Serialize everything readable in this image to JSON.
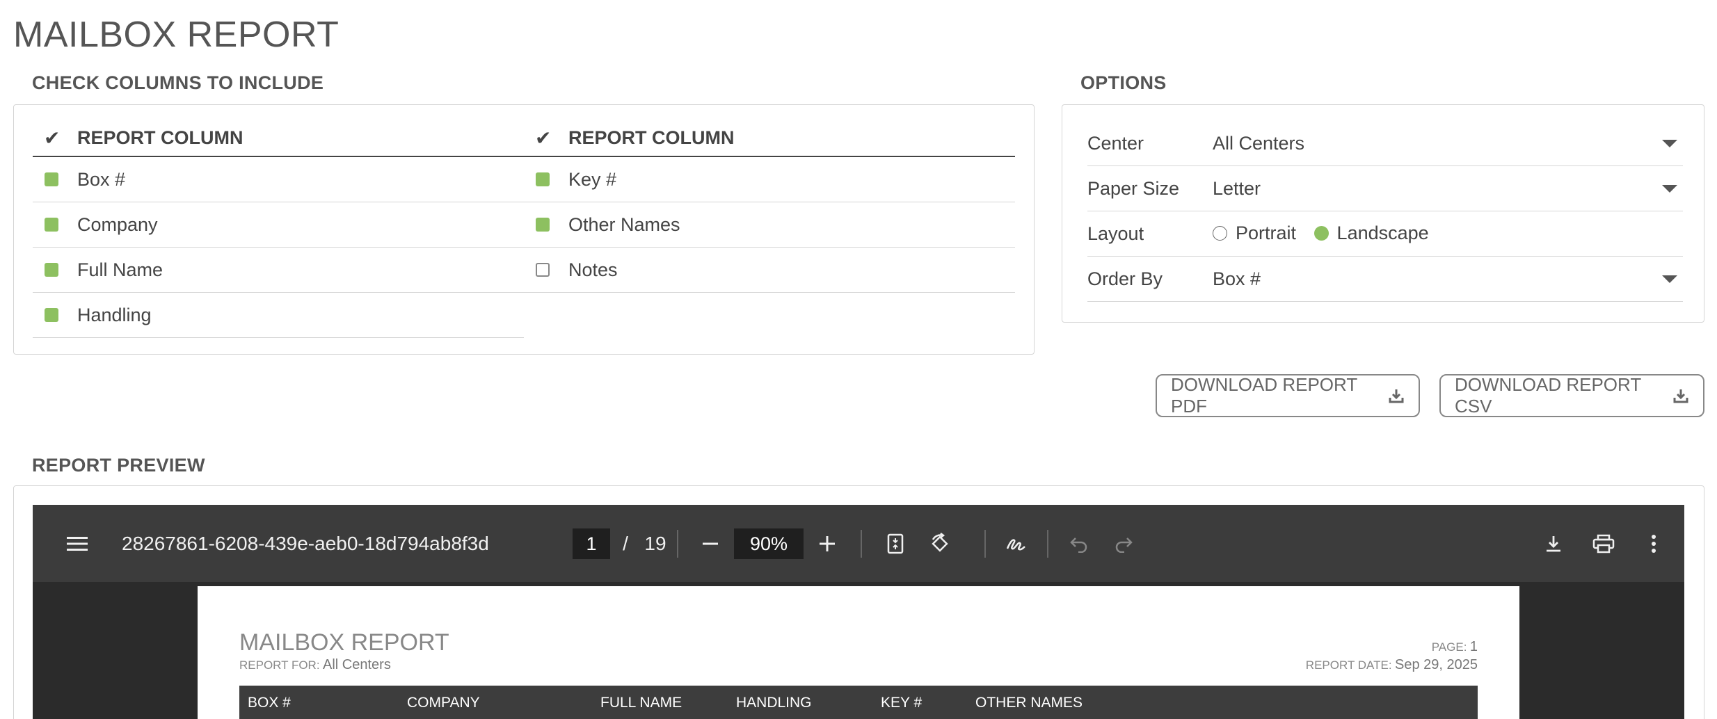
{
  "page": {
    "title": "MAILBOX REPORT"
  },
  "columns_section": {
    "heading": "CHECK COLUMNS TO INCLUDE",
    "left": {
      "header": "REPORT COLUMN",
      "items": [
        {
          "label": "Box #",
          "checked": true
        },
        {
          "label": "Company",
          "checked": true
        },
        {
          "label": "Full Name",
          "checked": true
        },
        {
          "label": "Handling",
          "checked": true
        }
      ]
    },
    "right": {
      "header": "REPORT COLUMN",
      "items": [
        {
          "label": "Key #",
          "checked": true
        },
        {
          "label": "Other Names",
          "checked": true
        },
        {
          "label": "Notes",
          "checked": false
        }
      ]
    }
  },
  "options": {
    "heading": "OPTIONS",
    "center": {
      "label": "Center",
      "value": "All Centers"
    },
    "paper_size": {
      "label": "Paper Size",
      "value": "Letter"
    },
    "layout": {
      "label": "Layout",
      "portrait_label": "Portrait",
      "landscape_label": "Landscape",
      "selected": "Landscape"
    },
    "order_by": {
      "label": "Order By",
      "value": "Box #"
    }
  },
  "downloads": {
    "pdf_label": "DOWNLOAD REPORT PDF",
    "csv_label": "DOWNLOAD REPORT CSV"
  },
  "preview": {
    "heading": "REPORT PREVIEW",
    "viewer": {
      "file_name": "28267861-6208-439e-aeb0-18d794ab8f3d",
      "current_page": "1",
      "page_separator": "/",
      "total_pages": "19",
      "zoom": "90%"
    },
    "document": {
      "title": "MAILBOX REPORT",
      "report_for_label": "REPORT FOR:",
      "report_for_value": "All Centers",
      "page_label": "PAGE:",
      "page_value": "1",
      "report_date_label": "REPORT DATE:",
      "report_date_value": "Sep 29, 2025",
      "table_headers": [
        "BOX #",
        "COMPANY",
        "FULL NAME",
        "HANDLING",
        "KEY #",
        "OTHER NAMES"
      ]
    }
  },
  "colors": {
    "accent_green": "#8dc060",
    "viewer_toolbar": "#3c3c3c",
    "viewer_background": "#2b2b2b"
  }
}
